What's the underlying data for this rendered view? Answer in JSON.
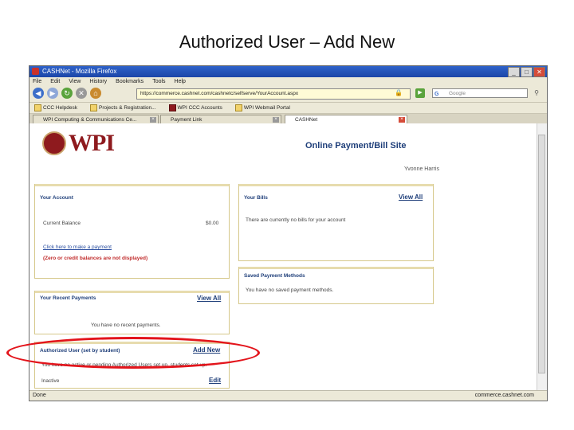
{
  "slide": {
    "title": "Authorized User – Add New"
  },
  "browser": {
    "window_title": "CASHNet - Mozilla Firefox",
    "window_buttons": [
      "_",
      "□",
      "✕"
    ],
    "menu": [
      "File",
      "Edit",
      "View",
      "History",
      "Bookmarks",
      "Tools",
      "Help"
    ],
    "url": "https://commerce.cashnet.com/cashnetc/selfserve/YourAccount.aspx",
    "search_placeholder": "Google",
    "bookmarks": [
      "CCC Helpdesk",
      "Projects & Registration...",
      "WPI CCC Accounts",
      "WPI Webmail Portal"
    ],
    "tabs": [
      "WPI Computing & Communications Ce...",
      "Payment Link",
      "CASHNet"
    ],
    "status_left": "Done",
    "status_right": "commerce.cashnet.com"
  },
  "page": {
    "logo_text": "WPI",
    "site_title": "Online Payment/Bill Site",
    "user_name": "Yvonne Harris",
    "your_account": {
      "title": "Your Account",
      "balance_label": "Current Balance",
      "balance_value": "$0.00",
      "pay_link": "Click here to make a payment",
      "note": "(Zero or credit balances are not displayed)"
    },
    "your_bills": {
      "title": "Your Bills",
      "view_all": "View All",
      "message": "There are currently no bills for your account"
    },
    "saved_payment": {
      "title": "Saved Payment Methods",
      "message": "You have no saved payment methods."
    },
    "recent_payments": {
      "title": "Your Recent Payments",
      "view_all": "View All",
      "message": "You have no recent payments."
    },
    "authorized_users": {
      "title": "Authorized User (set by student)",
      "add_new": "Add New",
      "message": "You have no active or pending Authorized Users set up. students set up.",
      "edit": "Edit",
      "status": "Inactive"
    }
  },
  "colors": {
    "highlight_oval": "#e3141b",
    "brand": "#8e1a1e",
    "link": "#1f3f7a"
  }
}
